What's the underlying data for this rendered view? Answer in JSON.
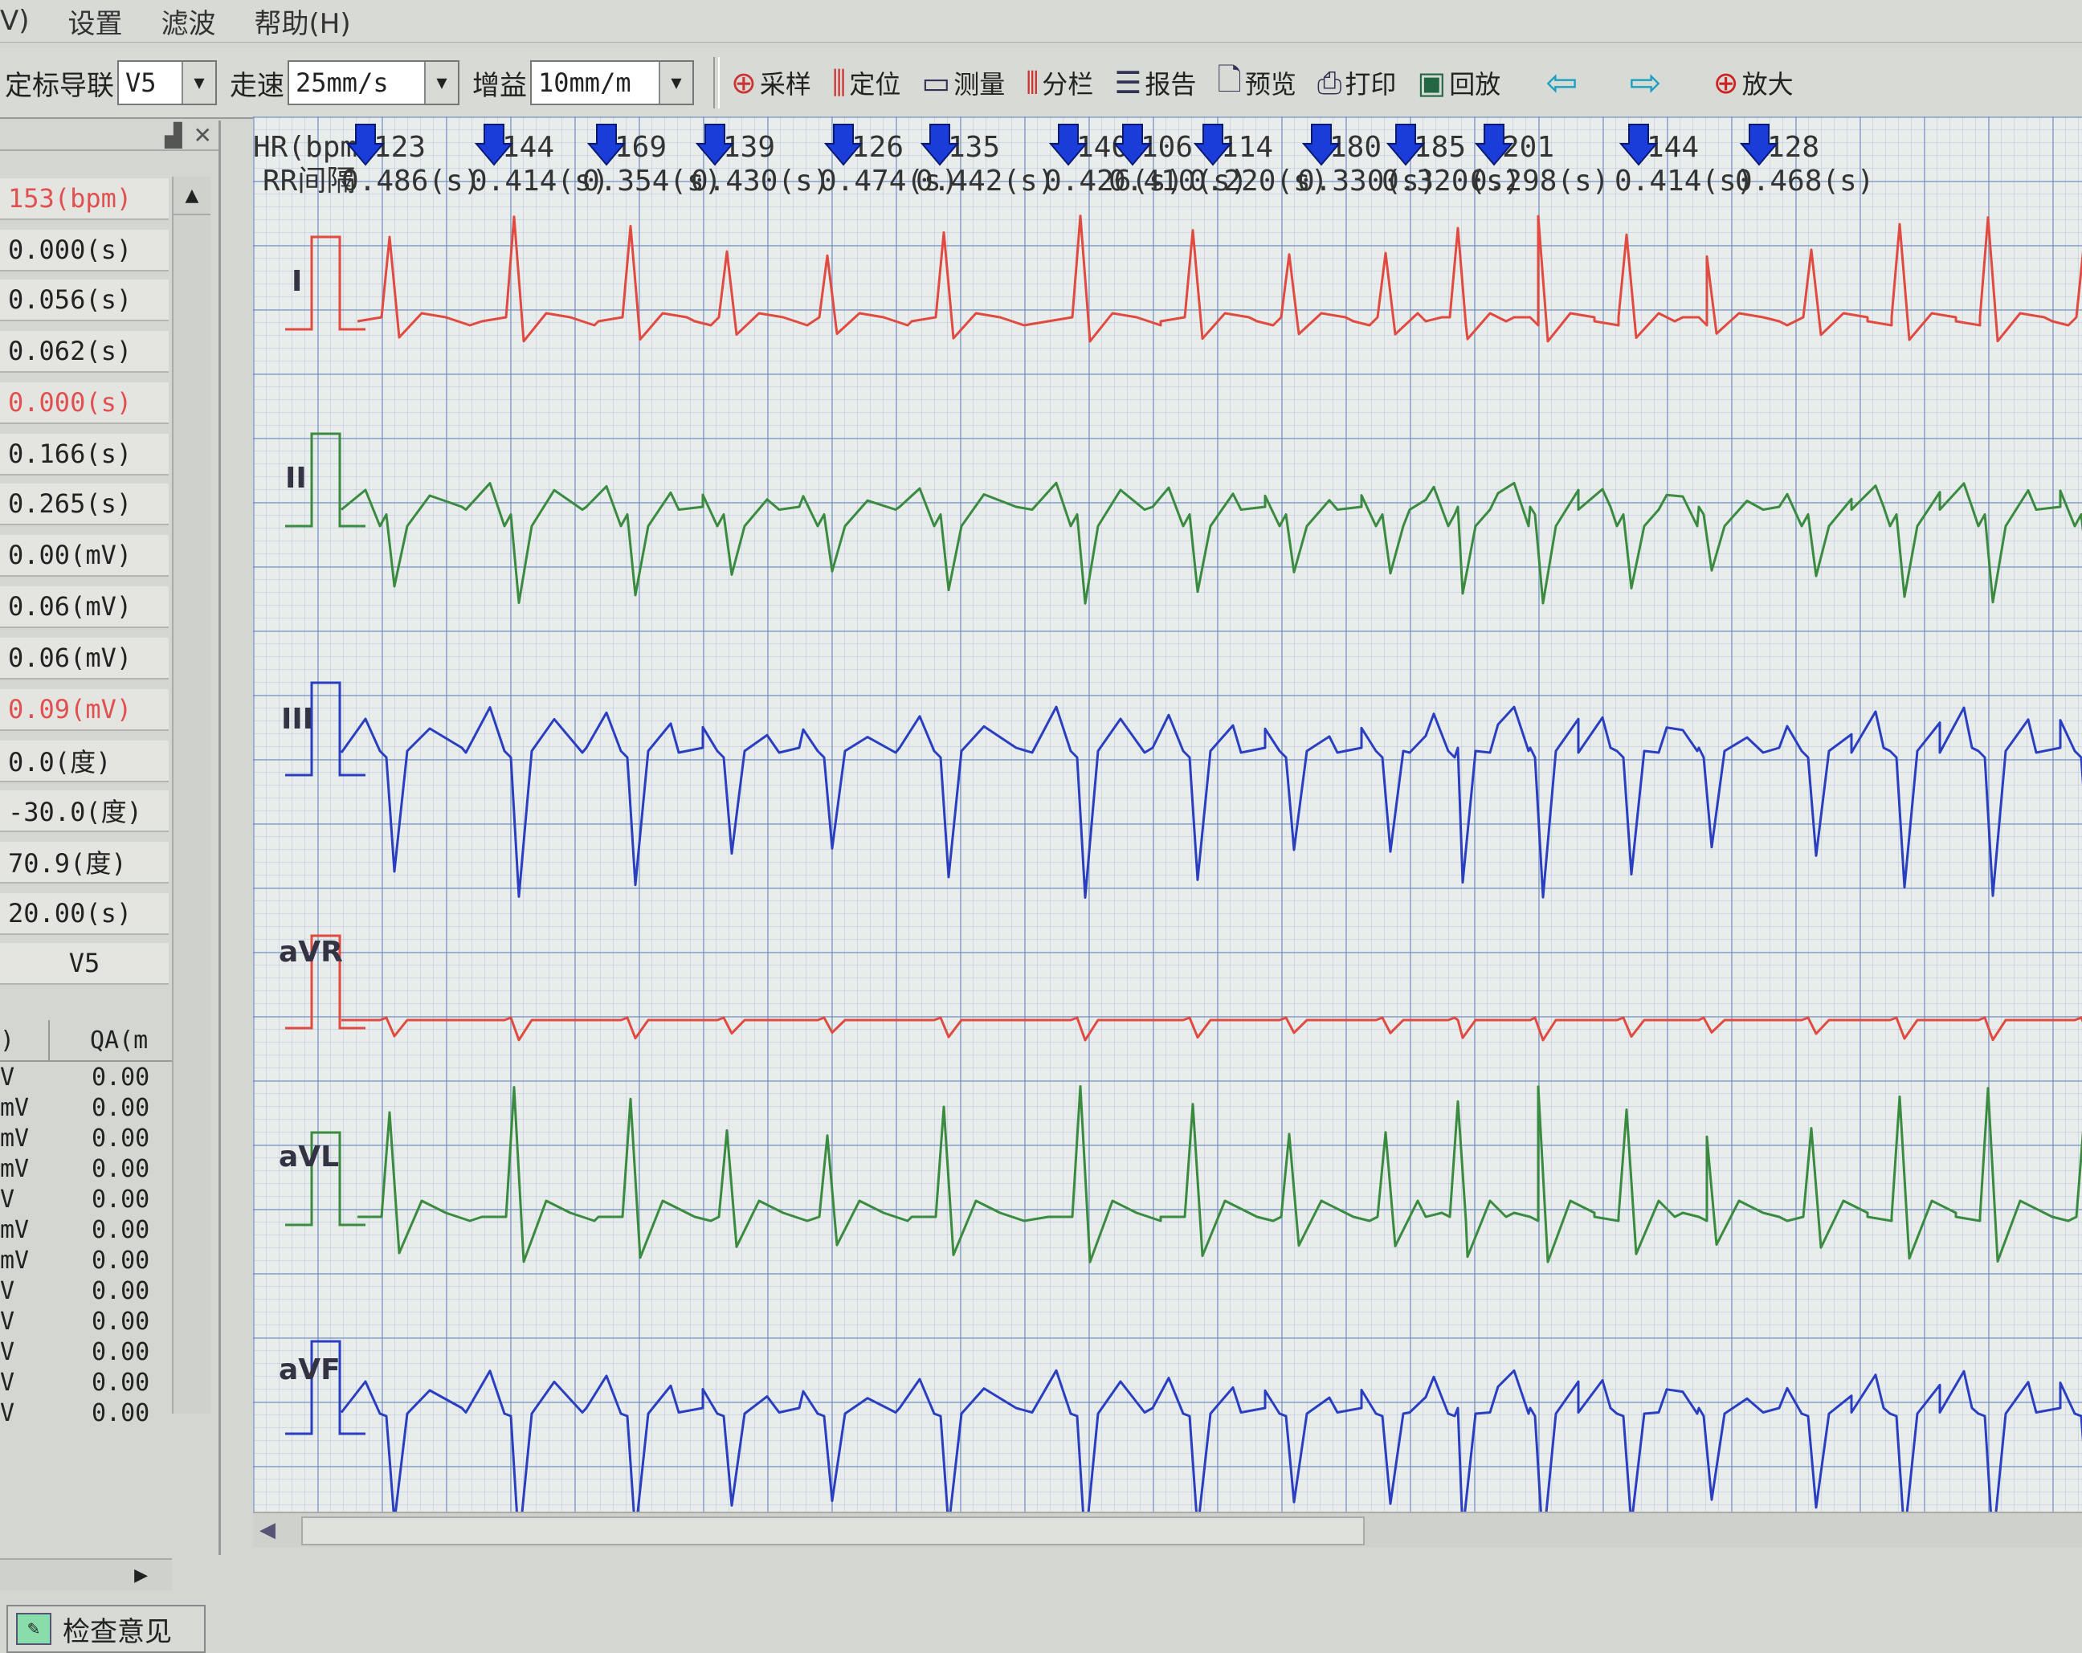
{
  "menu": {
    "items": [
      "V)",
      "设置",
      "滤波",
      "帮助(H)"
    ]
  },
  "toolbar": {
    "lead_label": "定标导联",
    "lead_value": "V5",
    "speed_label": "走速",
    "speed_value": "25mm/s",
    "gain_label": "增益",
    "gain_value": "10mm/m",
    "buttons": [
      {
        "label": "采样",
        "icon": "sample-icon"
      },
      {
        "label": "定位",
        "icon": "locate-icon"
      },
      {
        "label": "测量",
        "icon": "ruler-icon"
      },
      {
        "label": "分栏",
        "icon": "columns-icon"
      },
      {
        "label": "报告",
        "icon": "report-icon"
      },
      {
        "label": "预览",
        "icon": "preview-icon"
      },
      {
        "label": "打印",
        "icon": "print-icon"
      },
      {
        "label": "回放",
        "icon": "playback-icon"
      },
      {
        "label": "",
        "icon": "arrow-left-icon"
      },
      {
        "label": "",
        "icon": "arrow-right-icon"
      },
      {
        "label": "放大",
        "icon": "zoom-in-icon"
      }
    ]
  },
  "left_panel": {
    "measurements": [
      {
        "value": "153(bpm)",
        "highlight": true
      },
      {
        "value": "0.000(s)",
        "highlight": false
      },
      {
        "value": "0.056(s)",
        "highlight": false
      },
      {
        "value": "0.062(s)",
        "highlight": false
      },
      {
        "value": "0.000(s)",
        "highlight": true
      },
      {
        "value": "0.166(s)",
        "highlight": false
      },
      {
        "value": "0.265(s)",
        "highlight": false
      },
      {
        "value": "0.00(mV)",
        "highlight": false
      },
      {
        "value": "0.06(mV)",
        "highlight": false
      },
      {
        "value": "0.06(mV)",
        "highlight": false
      },
      {
        "value": "0.09(mV)",
        "highlight": true
      },
      {
        "value": "0.0(度)",
        "highlight": false
      },
      {
        "value": "-30.0(度)",
        "highlight": false
      },
      {
        "value": "70.9(度)",
        "highlight": false
      },
      {
        "value": "20.00(s)",
        "highlight": false
      },
      {
        "value": "V5",
        "highlight": false
      }
    ],
    "table": {
      "col1_header": ")",
      "col2_header": "QA(m",
      "rows": [
        {
          "c1": "V",
          "c2": "0.00"
        },
        {
          "c1": "mV",
          "c2": "0.00"
        },
        {
          "c1": "mV",
          "c2": "0.00"
        },
        {
          "c1": "mV",
          "c2": "0.00"
        },
        {
          "c1": "V",
          "c2": "0.00"
        },
        {
          "c1": "mV",
          "c2": "0.00"
        },
        {
          "c1": "mV",
          "c2": "0.00"
        },
        {
          "c1": "V",
          "c2": "0.00"
        },
        {
          "c1": "V",
          "c2": "0.00"
        },
        {
          "c1": "V",
          "c2": "0.00"
        },
        {
          "c1": "V",
          "c2": "0.00"
        },
        {
          "c1": "V",
          "c2": "0.00"
        }
      ]
    },
    "exam_button": "检查意见"
  },
  "ecg": {
    "hr_label": "HR(bpm)",
    "rr_label": "RR间隔",
    "hr_values": [
      "123",
      "144",
      "169",
      "139",
      "126",
      "135",
      "140",
      "106",
      "114",
      "180",
      "185",
      "201",
      "144",
      "128"
    ],
    "rr_values": [
      "0.486",
      "0.414",
      "0.354",
      "0.430",
      "0.474",
      "0.442",
      "0.426",
      "0.410",
      "0.220",
      "0.330",
      "0.320",
      "0.298",
      "0.414",
      "0.468"
    ],
    "rr_unit": "(s)",
    "leads": [
      {
        "name": "I",
        "color": "#e04a40"
      },
      {
        "name": "II",
        "color": "#3a8a40"
      },
      {
        "name": "III",
        "color": "#2a3ec0"
      },
      {
        "name": "aVR",
        "color": "#e04a40"
      },
      {
        "name": "aVL",
        "color": "#3a8a40"
      },
      {
        "name": "aVF",
        "color": "#2a3ec0"
      }
    ],
    "marker_color": "#1a3cd8"
  }
}
